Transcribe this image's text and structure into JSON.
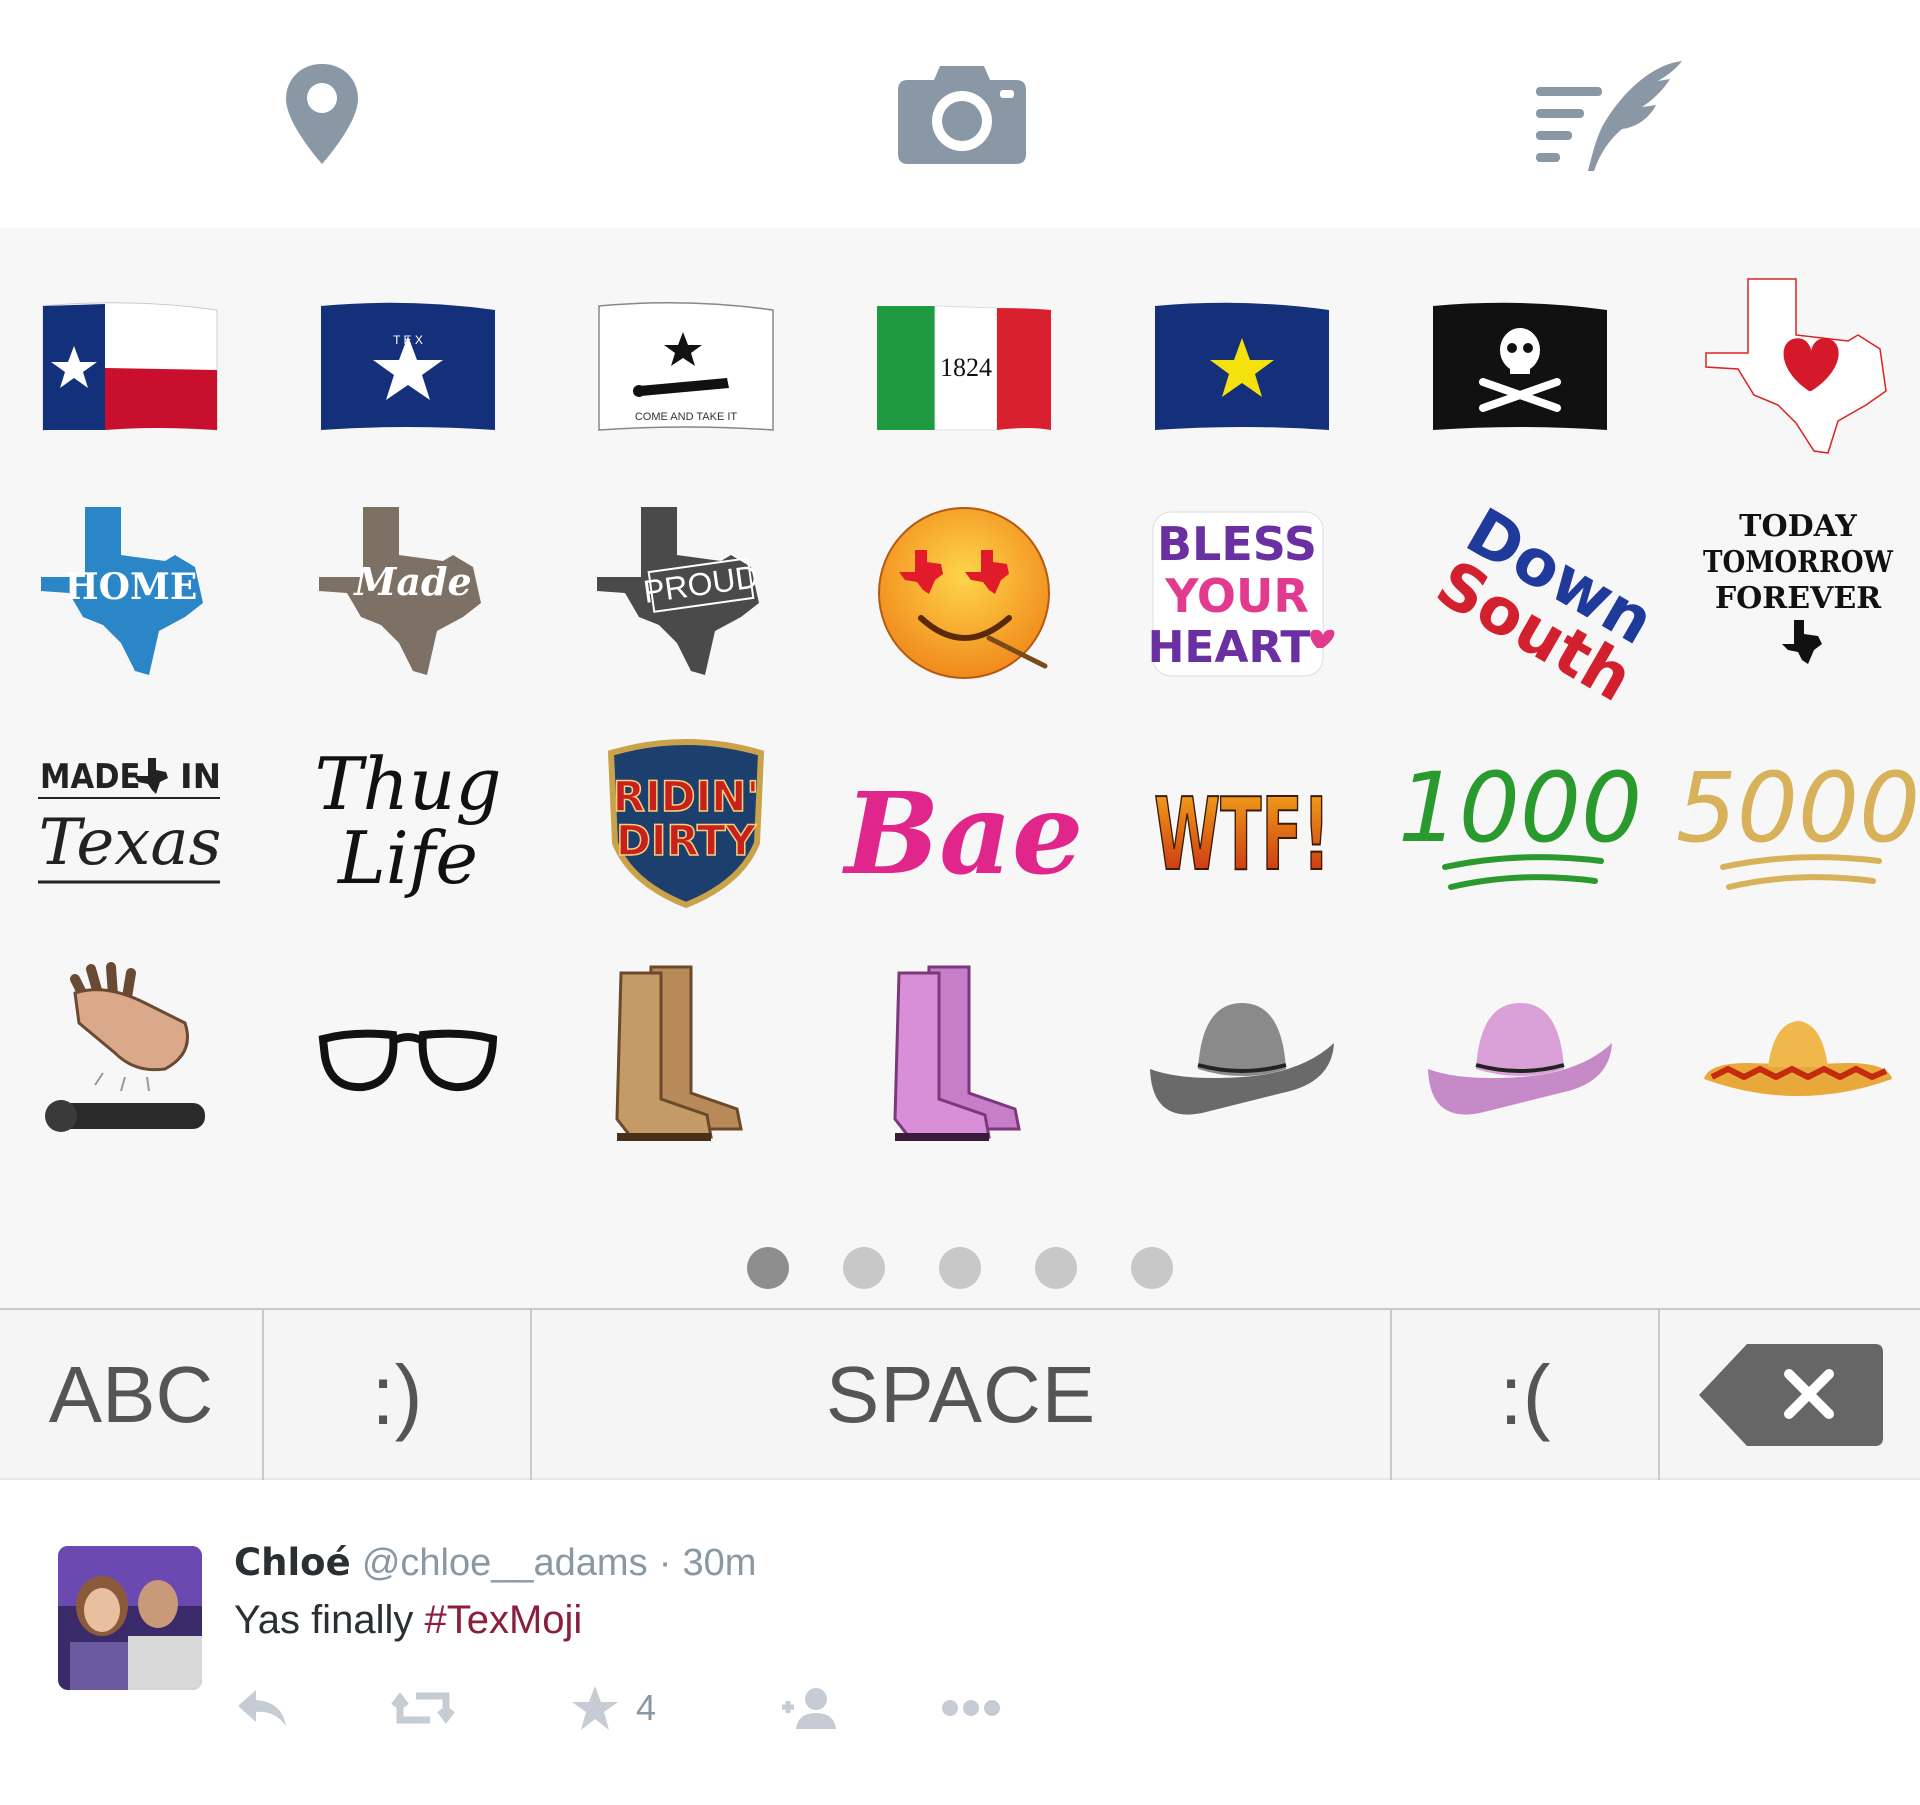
{
  "toolbar": {
    "icons": [
      "location-pin-icon",
      "camera-icon",
      "compose-quill-icon"
    ],
    "icon_color": "#8a98a6"
  },
  "emoji_grid": {
    "row1": [
      "texas-flag",
      "zavala-star-flag",
      "come-and-take-it-flag",
      "1824-flag",
      "burnet-flag",
      "pirate-flag",
      "texas-heart"
    ],
    "row2": [
      "texas-home",
      "texas-made",
      "texas-proud",
      "texas-eyes-smiley",
      "bless-your-heart",
      "down-south",
      "today-tomorrow-forever"
    ],
    "row3": [
      "made-in-texas",
      "thug-life",
      "ridin-dirty",
      "bae",
      "wtf",
      "1000",
      "5000"
    ],
    "row4": [
      "mic-drop-hand",
      "glasses",
      "brown-boots",
      "pink-boots",
      "gray-cowboy-hat",
      "pink-cowboy-hat",
      "sombrero"
    ],
    "stickers": {
      "come_and_take_it": "COME AND TAKE IT",
      "year_1824": "1824",
      "home": "HOME",
      "made": "Made",
      "proud": "PROUD",
      "bless_line1": "BLESS",
      "bless_line2": "YOUR",
      "bless_line3": "HEART",
      "down": "Down",
      "south": "South",
      "today": "TODAY",
      "tomorrow": "TOMORROW",
      "forever": "FOREVER",
      "made_word": "MADE",
      "in_word": "IN",
      "texas_word": "Texas",
      "thug": "Thug",
      "life": "Life",
      "ridin": "RIDIN'",
      "dirty": "DIRTY",
      "bae": "Bae",
      "wtf": "WTF!",
      "n1000": "1000",
      "n5000": "5000"
    }
  },
  "pager": {
    "pages": 5,
    "active": 1
  },
  "keys": {
    "abc": "ABC",
    "smile": ":)",
    "space": "SPACE",
    "sad": ":(",
    "delete_icon": "backspace-icon"
  },
  "tweet": {
    "name": "Chloé",
    "handle": "@chloe__adams",
    "separator": "·",
    "time": "30m",
    "text": "Yas finally",
    "hashtag": "#TexMoji",
    "favorites": "4"
  }
}
